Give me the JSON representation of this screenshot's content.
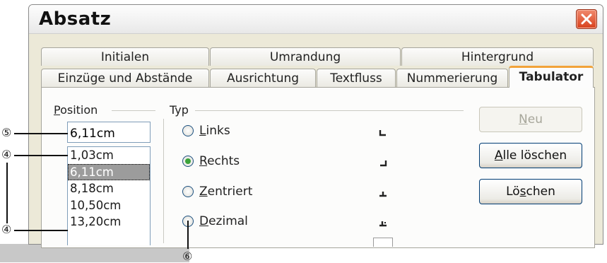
{
  "window": {
    "title": "Absatz"
  },
  "tabs_row1": [
    {
      "label": "Initialen"
    },
    {
      "label": "Umrandung"
    },
    {
      "label": "Hintergrund"
    }
  ],
  "tabs_row2": [
    {
      "label": "Einzüge und Abstände"
    },
    {
      "label": "Ausrichtung"
    },
    {
      "label": "Textfluss"
    },
    {
      "label": "Nummerierung"
    },
    {
      "label": "Tabulator",
      "active": true
    }
  ],
  "position": {
    "label_accel": "P",
    "label_rest": "osition",
    "value": "6,11cm",
    "list": [
      "1,03cm",
      "6,11cm",
      "8,18cm",
      "10,50cm",
      "13,20cm"
    ],
    "selected_index": 1
  },
  "type": {
    "label": "Typ",
    "options": [
      {
        "accel": "L",
        "rest": "inks",
        "selected": false
      },
      {
        "accel": "R",
        "rest": "echts",
        "selected": true
      },
      {
        "accel": "Z",
        "rest": "entriert",
        "selected": false
      },
      {
        "accel": "D",
        "rest": "ezimal",
        "selected": false
      }
    ]
  },
  "buttons": {
    "new_accel": "N",
    "new_rest": "eu",
    "delete_all_accel": "A",
    "delete_all_rest": "lle löschen",
    "delete_pre": "Lö",
    "delete_accel": "s",
    "delete_post": "chen"
  },
  "callouts": {
    "c5": "⑤",
    "c4a": "④",
    "c4b": "④",
    "c6": "⑥"
  },
  "colors": {
    "accent_tab": "#f2a33a",
    "close": "#d8401c",
    "radio_on": "#3ca33a"
  }
}
